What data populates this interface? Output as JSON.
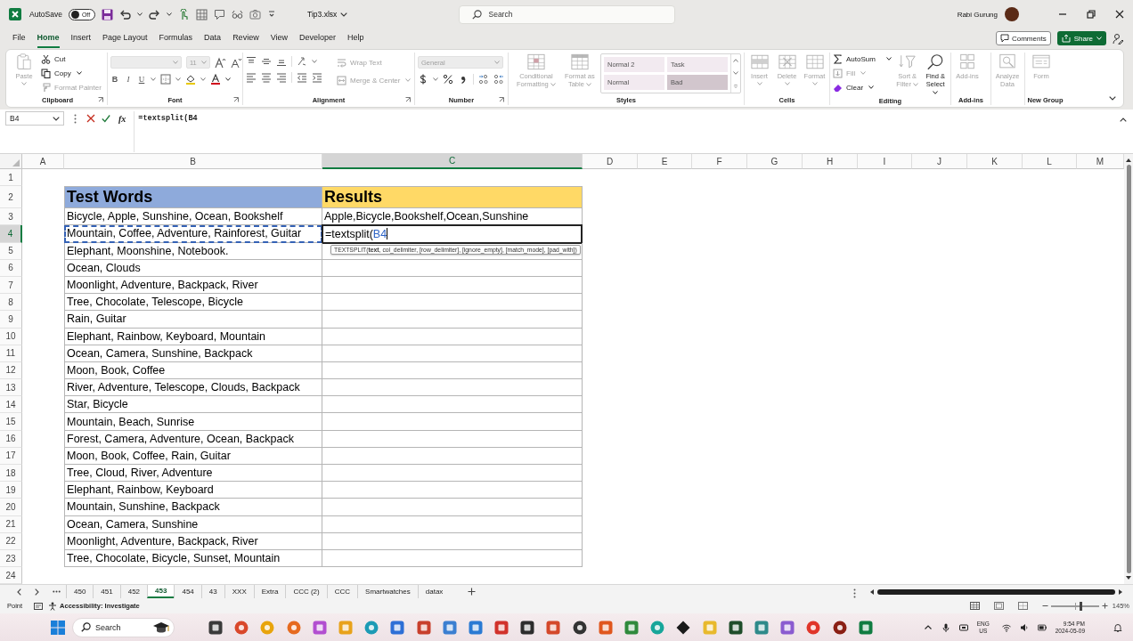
{
  "title_bar": {
    "autosave": {
      "label": "AutoSave",
      "on": false,
      "state_text": "Off"
    },
    "file_name": "Tip3.xlsx",
    "search_placeholder": "Search",
    "user_name": "Rabi Gurung"
  },
  "menu_tabs": [
    {
      "label": "File",
      "selected": false
    },
    {
      "label": "Home",
      "selected": true
    },
    {
      "label": "Insert",
      "selected": false
    },
    {
      "label": "Page Layout",
      "selected": false
    },
    {
      "label": "Formulas",
      "selected": false
    },
    {
      "label": "Data",
      "selected": false
    },
    {
      "label": "Review",
      "selected": false
    },
    {
      "label": "View",
      "selected": false
    },
    {
      "label": "Developer",
      "selected": false
    },
    {
      "label": "Help",
      "selected": false
    }
  ],
  "comments_button": "Comments",
  "share_button": "Share",
  "ribbon": {
    "clipboard": {
      "label": "Clipboard",
      "paste": {
        "label": "Paste",
        "disabled": true
      },
      "cut": {
        "label": "Cut",
        "disabled": false
      },
      "copy": {
        "label": "Copy",
        "disabled": false
      },
      "format_painter": {
        "label": "Format Painter",
        "disabled": true
      }
    },
    "font": {
      "label": "Font",
      "font_name": {
        "disabled": true
      },
      "font_size": {
        "value": "11",
        "disabled": true
      },
      "bold": "B",
      "italic": "I",
      "underline": "U"
    },
    "alignment": {
      "label": "Alignment",
      "wrap_text": {
        "label": "Wrap Text",
        "disabled": true
      },
      "merge_center": {
        "label": "Merge & Center",
        "disabled": true
      }
    },
    "number": {
      "label": "Number",
      "format": {
        "value": "General",
        "disabled": true
      }
    },
    "styles": {
      "label": "Styles",
      "conditional_formatting": {
        "label": "Conditional Formatting",
        "disabled": true
      },
      "format_as_table": {
        "label": "Format as Table",
        "disabled": true
      },
      "gallery": [
        {
          "label": "Normal 2",
          "color": "#f2eaf0"
        },
        {
          "label": "Task",
          "color": "#f2eaf0"
        },
        {
          "label": "Normal",
          "color": "#f2eaf0"
        },
        {
          "label": "Bad",
          "color": "#d2c6cd"
        }
      ]
    },
    "cells": {
      "label": "Cells",
      "insert": {
        "label": "Insert",
        "disabled": true
      },
      "delete": {
        "label": "Delete",
        "disabled": true
      },
      "format": {
        "label": "Format",
        "disabled": true
      }
    },
    "editing": {
      "label": "Editing",
      "autosum": {
        "label": "AutoSum",
        "disabled": false
      },
      "fill": {
        "label": "Fill",
        "disabled": true
      },
      "clear": {
        "label": "Clear",
        "disabled": false
      },
      "sort_filter": {
        "label": "Sort & Filter",
        "disabled": true
      },
      "find_select": {
        "label": "Find & Select",
        "disabled": false
      }
    },
    "add_ins": {
      "label": "Add-ins",
      "add_ins": {
        "label": "Add-ins",
        "disabled": true
      }
    },
    "analysis": {
      "analyze_data": {
        "label": "Analyze Data",
        "disabled": true
      }
    },
    "new_group": {
      "label": "New Group",
      "form": {
        "label": "Form",
        "disabled": true
      }
    }
  },
  "formula_bar": {
    "name_box": "B4",
    "function_button": "fx",
    "formula": "=textsplit(B4"
  },
  "sheet": {
    "columns": [
      {
        "label": "A",
        "selected": false
      },
      {
        "label": "B",
        "selected": false
      },
      {
        "label": "C",
        "selected": true
      },
      {
        "label": "D",
        "selected": false
      },
      {
        "label": "E",
        "selected": false
      },
      {
        "label": "F",
        "selected": false
      },
      {
        "label": "G",
        "selected": false
      },
      {
        "label": "H",
        "selected": false
      },
      {
        "label": "I",
        "selected": false
      },
      {
        "label": "J",
        "selected": false
      },
      {
        "label": "K",
        "selected": false
      },
      {
        "label": "L",
        "selected": false
      },
      {
        "label": "M",
        "selected": false
      }
    ],
    "rows": [
      {
        "number": "1",
        "selected": false
      },
      {
        "number": "2",
        "selected": false,
        "cells": [
          {
            "kind": "heading",
            "text": "Test Words",
            "color": "#8eaadb"
          },
          {
            "kind": "heading",
            "text": "Results",
            "color": "#ffd966"
          }
        ]
      },
      {
        "number": "3",
        "selected": false,
        "cells": [
          {
            "kind": "text",
            "text": "Bicycle, Apple, Sunshine, Ocean, Bookshelf"
          },
          {
            "kind": "text",
            "text": "Apple,Bicycle,Bookshelf,Ocean,Sunshine"
          }
        ]
      },
      {
        "number": "4",
        "selected": true,
        "cells": [
          {
            "kind": "reference",
            "text": "Mountain, Coffee, Adventure, Rainforest, Guitar"
          },
          {
            "kind": "editing",
            "text": "=textsplit(",
            "reference": "B4"
          }
        ]
      },
      {
        "number": "5",
        "selected": false,
        "cells": [
          {
            "kind": "text",
            "text": "Elephant, Moonshine, Notebook."
          }
        ]
      },
      {
        "number": "6",
        "selected": false,
        "cells": [
          {
            "kind": "text",
            "text": "Ocean, Clouds"
          }
        ]
      },
      {
        "number": "7",
        "selected": false,
        "cells": [
          {
            "kind": "text",
            "text": "Moonlight, Adventure, Backpack, River"
          }
        ]
      },
      {
        "number": "8",
        "selected": false,
        "cells": [
          {
            "kind": "text",
            "text": "Tree, Chocolate, Telescope, Bicycle"
          }
        ]
      },
      {
        "number": "9",
        "selected": false,
        "cells": [
          {
            "kind": "text",
            "text": "Rain, Guitar"
          }
        ]
      },
      {
        "number": "10",
        "selected": false,
        "cells": [
          {
            "kind": "text",
            "text": "Elephant, Rainbow, Keyboard, Mountain"
          }
        ]
      },
      {
        "number": "11",
        "selected": false,
        "cells": [
          {
            "kind": "text",
            "text": "Ocean, Camera, Sunshine, Backpack"
          }
        ]
      },
      {
        "number": "12",
        "selected": false,
        "cells": [
          {
            "kind": "text",
            "text": "Moon, Book, Coffee"
          }
        ]
      },
      {
        "number": "13",
        "selected": false,
        "cells": [
          {
            "kind": "text",
            "text": "River, Adventure, Telescope, Clouds, Backpack"
          }
        ]
      },
      {
        "number": "14",
        "selected": false,
        "cells": [
          {
            "kind": "text",
            "text": "Star, Bicycle"
          }
        ]
      },
      {
        "number": "15",
        "selected": false,
        "cells": [
          {
            "kind": "text",
            "text": "Mountain, Beach, Sunrise"
          }
        ]
      },
      {
        "number": "16",
        "selected": false,
        "cells": [
          {
            "kind": "text",
            "text": "Forest, Camera, Adventure, Ocean, Backpack"
          }
        ]
      },
      {
        "number": "17",
        "selected": false,
        "cells": [
          {
            "kind": "text",
            "text": "Moon, Book, Coffee, Rain, Guitar"
          }
        ]
      },
      {
        "number": "18",
        "selected": false,
        "cells": [
          {
            "kind": "text",
            "text": "Tree, Cloud, River, Adventure"
          }
        ]
      },
      {
        "number": "19",
        "selected": false,
        "cells": [
          {
            "kind": "text",
            "text": "Elephant, Rainbow, Keyboard"
          }
        ]
      },
      {
        "number": "20",
        "selected": false,
        "cells": [
          {
            "kind": "text",
            "text": "Mountain, Sunshine, Backpack"
          }
        ]
      },
      {
        "number": "21",
        "selected": false,
        "cells": [
          {
            "kind": "text",
            "text": "Ocean, Camera, Sunshine"
          }
        ]
      },
      {
        "number": "22",
        "selected": false,
        "cells": [
          {
            "kind": "text",
            "text": "Moonlight, Adventure, Backpack, River"
          }
        ]
      },
      {
        "number": "23",
        "selected": false,
        "cells": [
          {
            "kind": "text",
            "text": "Tree, Chocolate, Bicycle, Sunset, Mountain"
          }
        ]
      },
      {
        "number": "24",
        "selected": false
      }
    ],
    "function_tooltip": "TEXTSPLIT(**text**, col_delimiter, [row_delimiter], [ignore_empty], [match_mode], [pad_with])"
  },
  "sheet_tabs": [
    {
      "label": "450",
      "selected": false
    },
    {
      "label": "451",
      "selected": false
    },
    {
      "label": "452",
      "selected": false
    },
    {
      "label": "453",
      "selected": true
    },
    {
      "label": "454",
      "selected": false
    },
    {
      "label": "43",
      "selected": false
    },
    {
      "label": "XXX",
      "selected": false
    },
    {
      "label": "Extra",
      "selected": false
    },
    {
      "label": "CCC (2)",
      "selected": false
    },
    {
      "label": "CCC",
      "selected": false
    },
    {
      "label": "Smartwatches",
      "selected": false
    },
    {
      "label": "datax",
      "selected": false
    }
  ],
  "status_bar": {
    "mode": "Point",
    "accessibility": "Accessibility: Investigate",
    "zoom": {
      "level": 0.62,
      "reading": "145%"
    }
  },
  "taskbar": {
    "search_placeholder": "Search",
    "language": "ENG",
    "region": "US",
    "time": "9:54 PM",
    "date": "2024-05-09"
  }
}
